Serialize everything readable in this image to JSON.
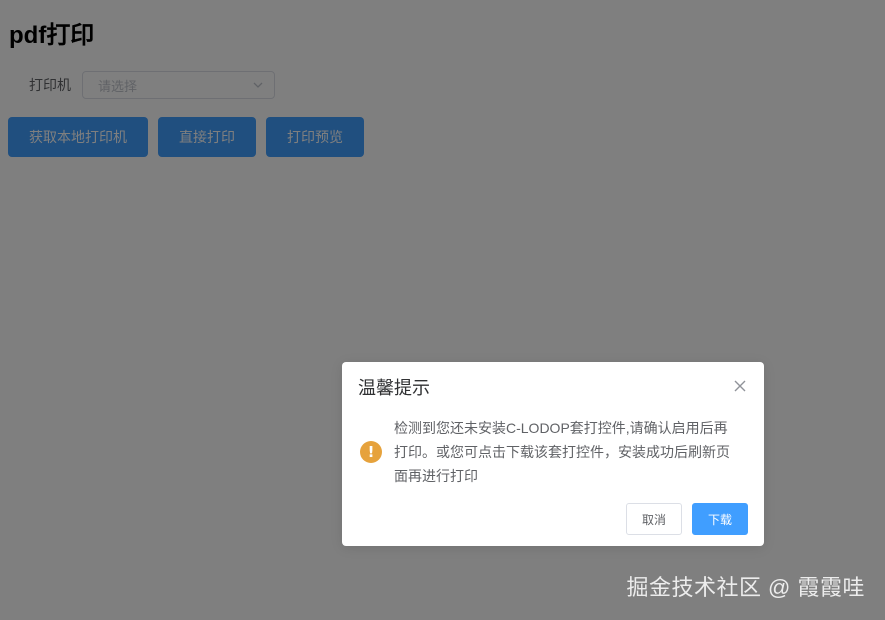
{
  "page": {
    "title": "pdf打印"
  },
  "form": {
    "printer_label": "打印机",
    "printer_select": {
      "placeholder": "请选择",
      "icon": "chevron-down-icon"
    }
  },
  "actions": {
    "get_printers_label": "获取本地打印机",
    "direct_print_label": "直接打印",
    "print_preview_label": "打印预览"
  },
  "dialog": {
    "title": "温馨提示",
    "icon": "warning-icon",
    "icon_glyph": "!",
    "message": "检测到您还未安装C-LODOP套打控件,请确认启用后再打印。或您可点击下载该套打控件，安装成功后刷新页面再进行打印",
    "cancel_label": "取消",
    "confirm_label": "下载",
    "close_icon": "close-icon"
  },
  "watermark": {
    "text": "掘金技术社区 @ 霞霞哇"
  },
  "colors": {
    "primary": "#409eff",
    "warning": "#e6a23c",
    "overlay": "rgba(0,0,0,0.5)"
  }
}
